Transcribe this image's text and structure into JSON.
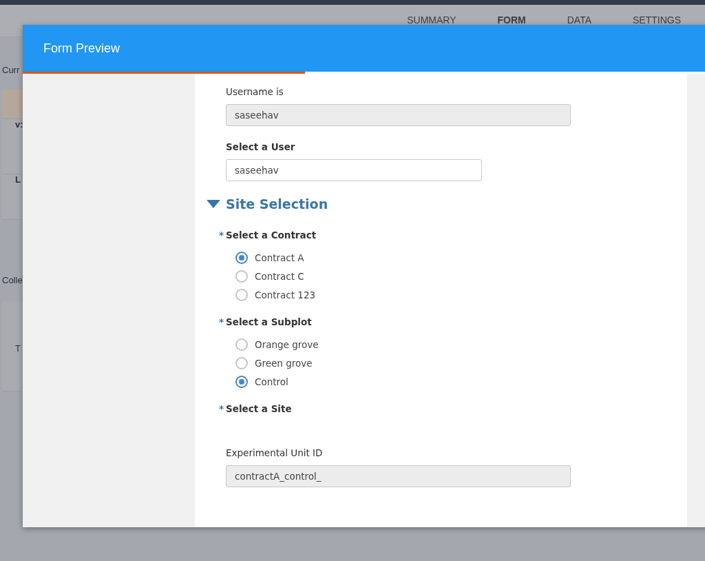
{
  "nav_tabs": [
    {
      "label": "SUMMARY",
      "selected": false
    },
    {
      "label": "FORM",
      "selected": true
    },
    {
      "label": "DATA",
      "selected": false
    },
    {
      "label": "SETTINGS",
      "selected": false
    }
  ],
  "background": {
    "current_label": "Curr",
    "version_label": "v:",
    "last_label": "L",
    "collection_label": "Colle",
    "card_text": "T"
  },
  "modal": {
    "title": "Form Preview",
    "progress": {
      "level": 0.41
    }
  },
  "form": [
    {
      "kind": "readonly",
      "label": "Username is",
      "value": "saseehav"
    },
    {
      "kind": "text",
      "label": "Select a User",
      "value": "saseehav"
    },
    {
      "kind": "section",
      "title": "Site Selection",
      "expanded": true
    },
    {
      "kind": "radio",
      "label": "Select a Contract",
      "required_mark": "*",
      "options": [
        {
          "label": "Contract A",
          "selected": true
        },
        {
          "label": "Contract C",
          "selected": false
        },
        {
          "label": "Contract 123",
          "selected": false
        }
      ]
    },
    {
      "kind": "radio",
      "label": "Select a Subplot",
      "required_mark": "*",
      "options": [
        {
          "label": "Orange grove",
          "selected": false
        },
        {
          "label": "Green grove",
          "selected": false
        },
        {
          "label": "Control",
          "selected": true
        }
      ]
    },
    {
      "kind": "label",
      "label": "Select a Site",
      "required_mark": "*"
    },
    {
      "kind": "readonly",
      "label": "Experimental Unit ID",
      "value": "contractA_control_"
    }
  ]
}
